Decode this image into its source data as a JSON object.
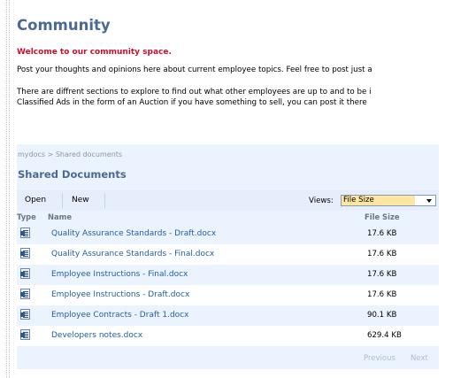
{
  "page": {
    "title": "Community",
    "welcome": "Welcome to our community space.",
    "paragraph1": "Post your thoughts and opinions here about current employee topics. Feel free to post just a",
    "paragraph2_line1": "There are diffrent sections to explore to find out what other employees are up to and to be i",
    "paragraph2_line2": "Classified Ads in the form of an Auction if you have something to sell, you can post it there"
  },
  "webpart": {
    "breadcrumb": "mydocs > Shared documents",
    "title": "Shared Documents",
    "toolbar": {
      "open_label": "Open",
      "new_label": "New",
      "views_label": "Views:",
      "views_value": "File Size"
    },
    "columns": {
      "type": "Type",
      "name": "Name",
      "size": "File Size"
    },
    "files": [
      {
        "name": "Quality Assurance Standards - Draft.docx",
        "size": "17.6 KB",
        "icon": "word-document-icon"
      },
      {
        "name": "Quality Assurance Standards - Final.docx",
        "size": "17.6 KB",
        "icon": "word-document-icon"
      },
      {
        "name": "Employee Instructions - Final.docx",
        "size": "17.6 KB",
        "icon": "word-document-icon"
      },
      {
        "name": "Employee Instructions - Draft.docx",
        "size": "17.6 KB",
        "icon": "word-document-icon"
      },
      {
        "name": "Employee Contracts - Draft 1.docx",
        "size": "90.1 KB",
        "icon": "word-document-icon"
      },
      {
        "name": "Developers notes.docx",
        "size": "629.4 KB",
        "icon": "word-document-icon"
      }
    ],
    "pager": {
      "previous": "Previous",
      "next": "Next"
    }
  },
  "colors": {
    "title": "#4a6a94",
    "welcome": "#c8102e",
    "link": "#1f5ea8",
    "panel_bg": "#ebf3ff",
    "views_highlight": "#ffe6a0"
  }
}
